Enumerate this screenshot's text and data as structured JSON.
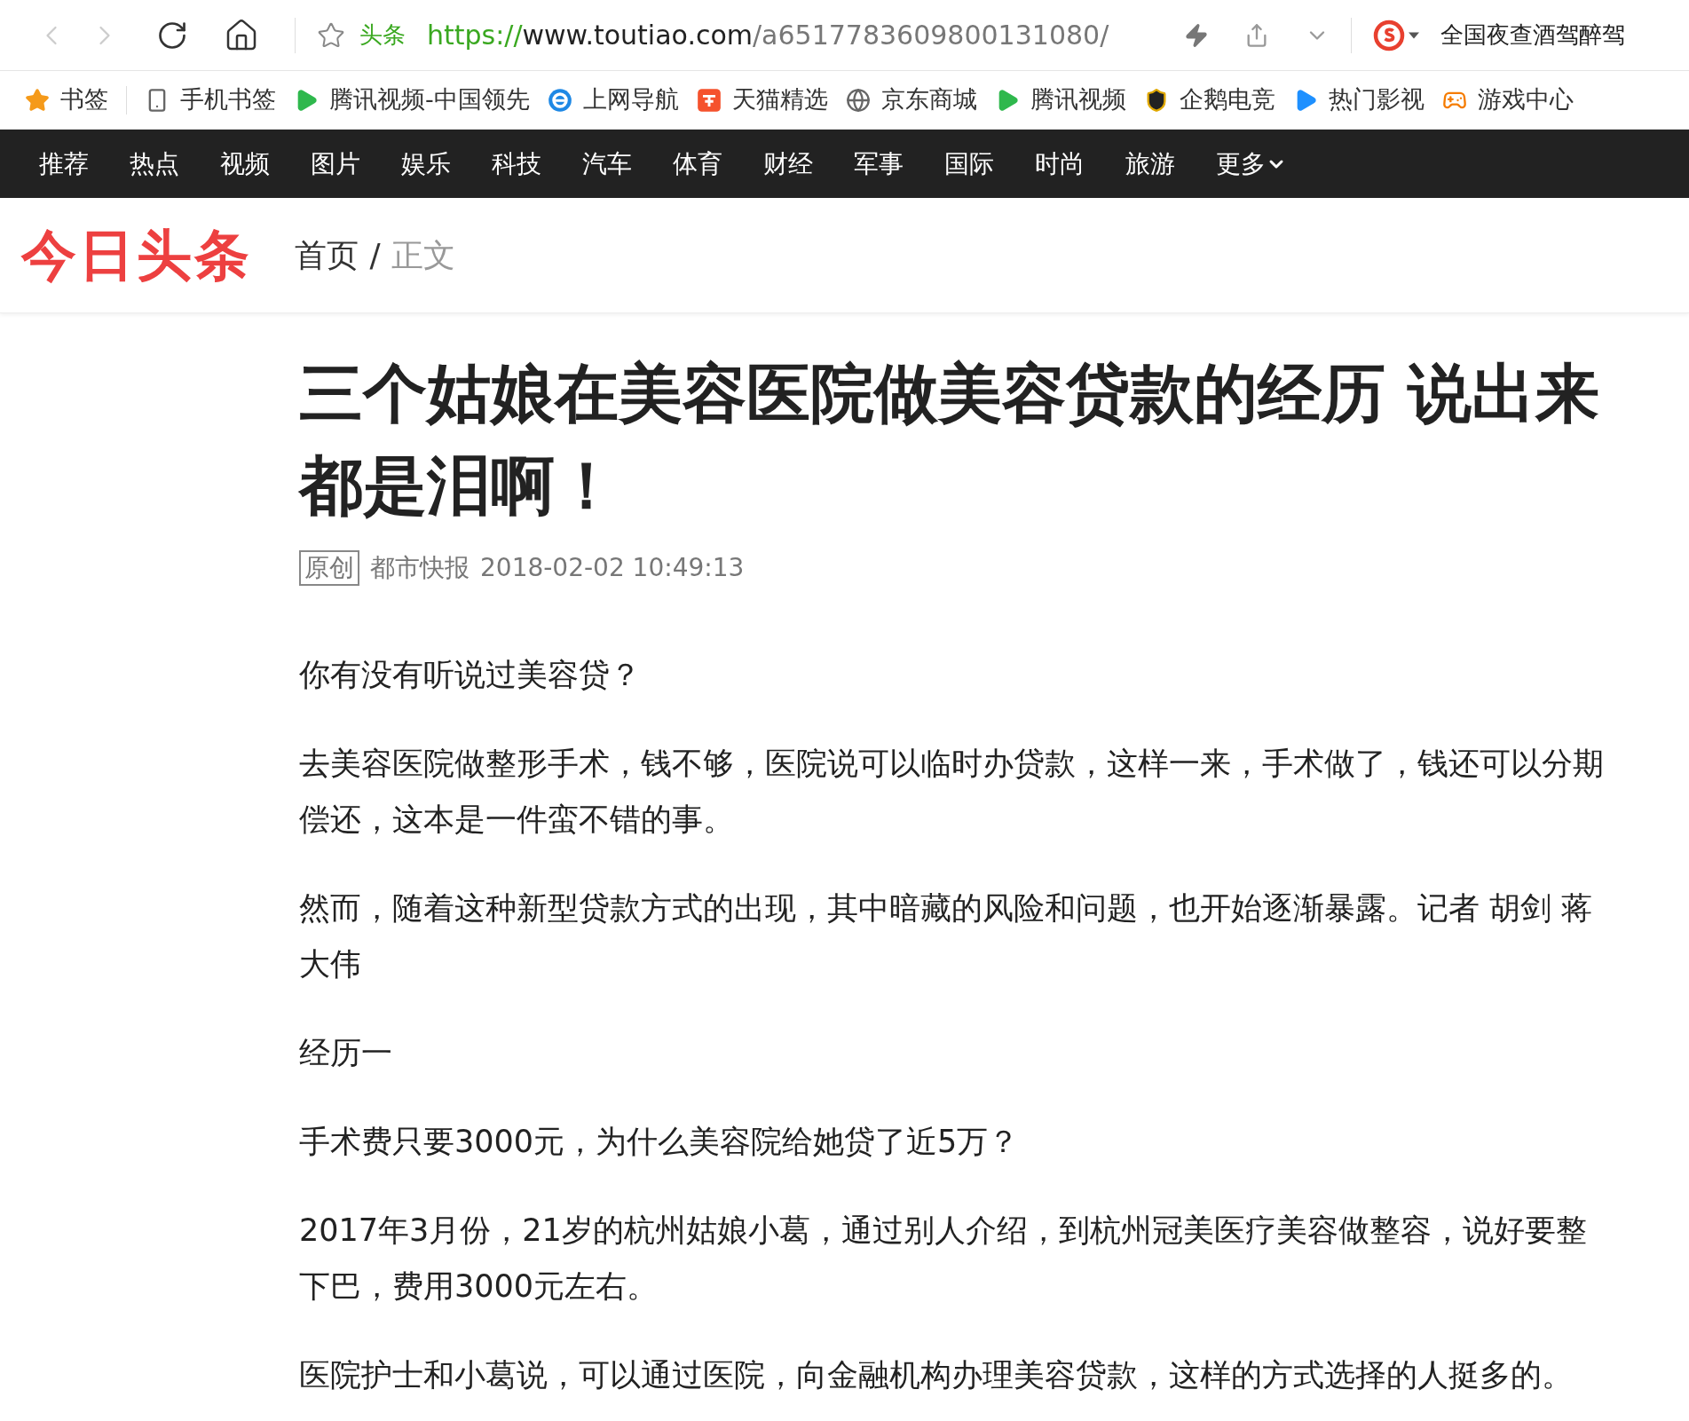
{
  "browser": {
    "site_label": "头条",
    "url_scheme": "https://",
    "url_host": "www.toutiao.com",
    "url_path": "/a6517783609800131080/",
    "search": {
      "placeholder": "全国夜查酒驾醉驾"
    }
  },
  "bookmarks": [
    {
      "kind": "star",
      "label": "书签"
    },
    {
      "kind": "phone",
      "label": "手机书签"
    },
    {
      "kind": "play",
      "label": "腾讯视频-中国领先"
    },
    {
      "kind": "ie",
      "label": "上网导航"
    },
    {
      "kind": "tmall",
      "label": "天猫精选"
    },
    {
      "kind": "globe",
      "label": "京东商城"
    },
    {
      "kind": "play",
      "label": "腾讯视频"
    },
    {
      "kind": "badge",
      "label": "企鹅电竞"
    },
    {
      "kind": "arrow",
      "label": "热门影视"
    },
    {
      "kind": "game",
      "label": "游戏中心"
    }
  ],
  "nav": {
    "items": [
      "推荐",
      "热点",
      "视频",
      "图片",
      "娱乐",
      "科技",
      "汽车",
      "体育",
      "财经",
      "军事",
      "国际",
      "时尚",
      "旅游"
    ],
    "more": "更多"
  },
  "header": {
    "logo": "今日头条",
    "breadcrumb": [
      {
        "label": "首页",
        "current": false
      },
      {
        "label": "正文",
        "current": true
      }
    ],
    "separator": "/"
  },
  "article": {
    "title": "三个姑娘在美容医院做美容贷款的经历 说出来都是泪啊！",
    "tag": "原创",
    "source": "都市快报",
    "time": "2018-02-02 10:49:13",
    "paragraphs": [
      "你有没有听说过美容贷？",
      "去美容医院做整形手术，钱不够，医院说可以临时办贷款，这样一来，手术做了，钱还可以分期偿还，这本是一件蛮不错的事。",
      "然而，随着这种新型贷款方式的出现，其中暗藏的风险和问题，也开始逐渐暴露。记者 胡剑 蒋大伟",
      "经历一",
      "手术费只要3000元，为什么美容院给她贷了近5万？",
      "2017年3月份，21岁的杭州姑娘小葛，通过别人介绍，到杭州冠美医疗美容做整容，说好要整下巴，费用3000元左右。",
      "医院护士和小葛说，可以通过医院，向金融机构办理美容贷款，这样的方式选择的人挺多的。"
    ]
  }
}
